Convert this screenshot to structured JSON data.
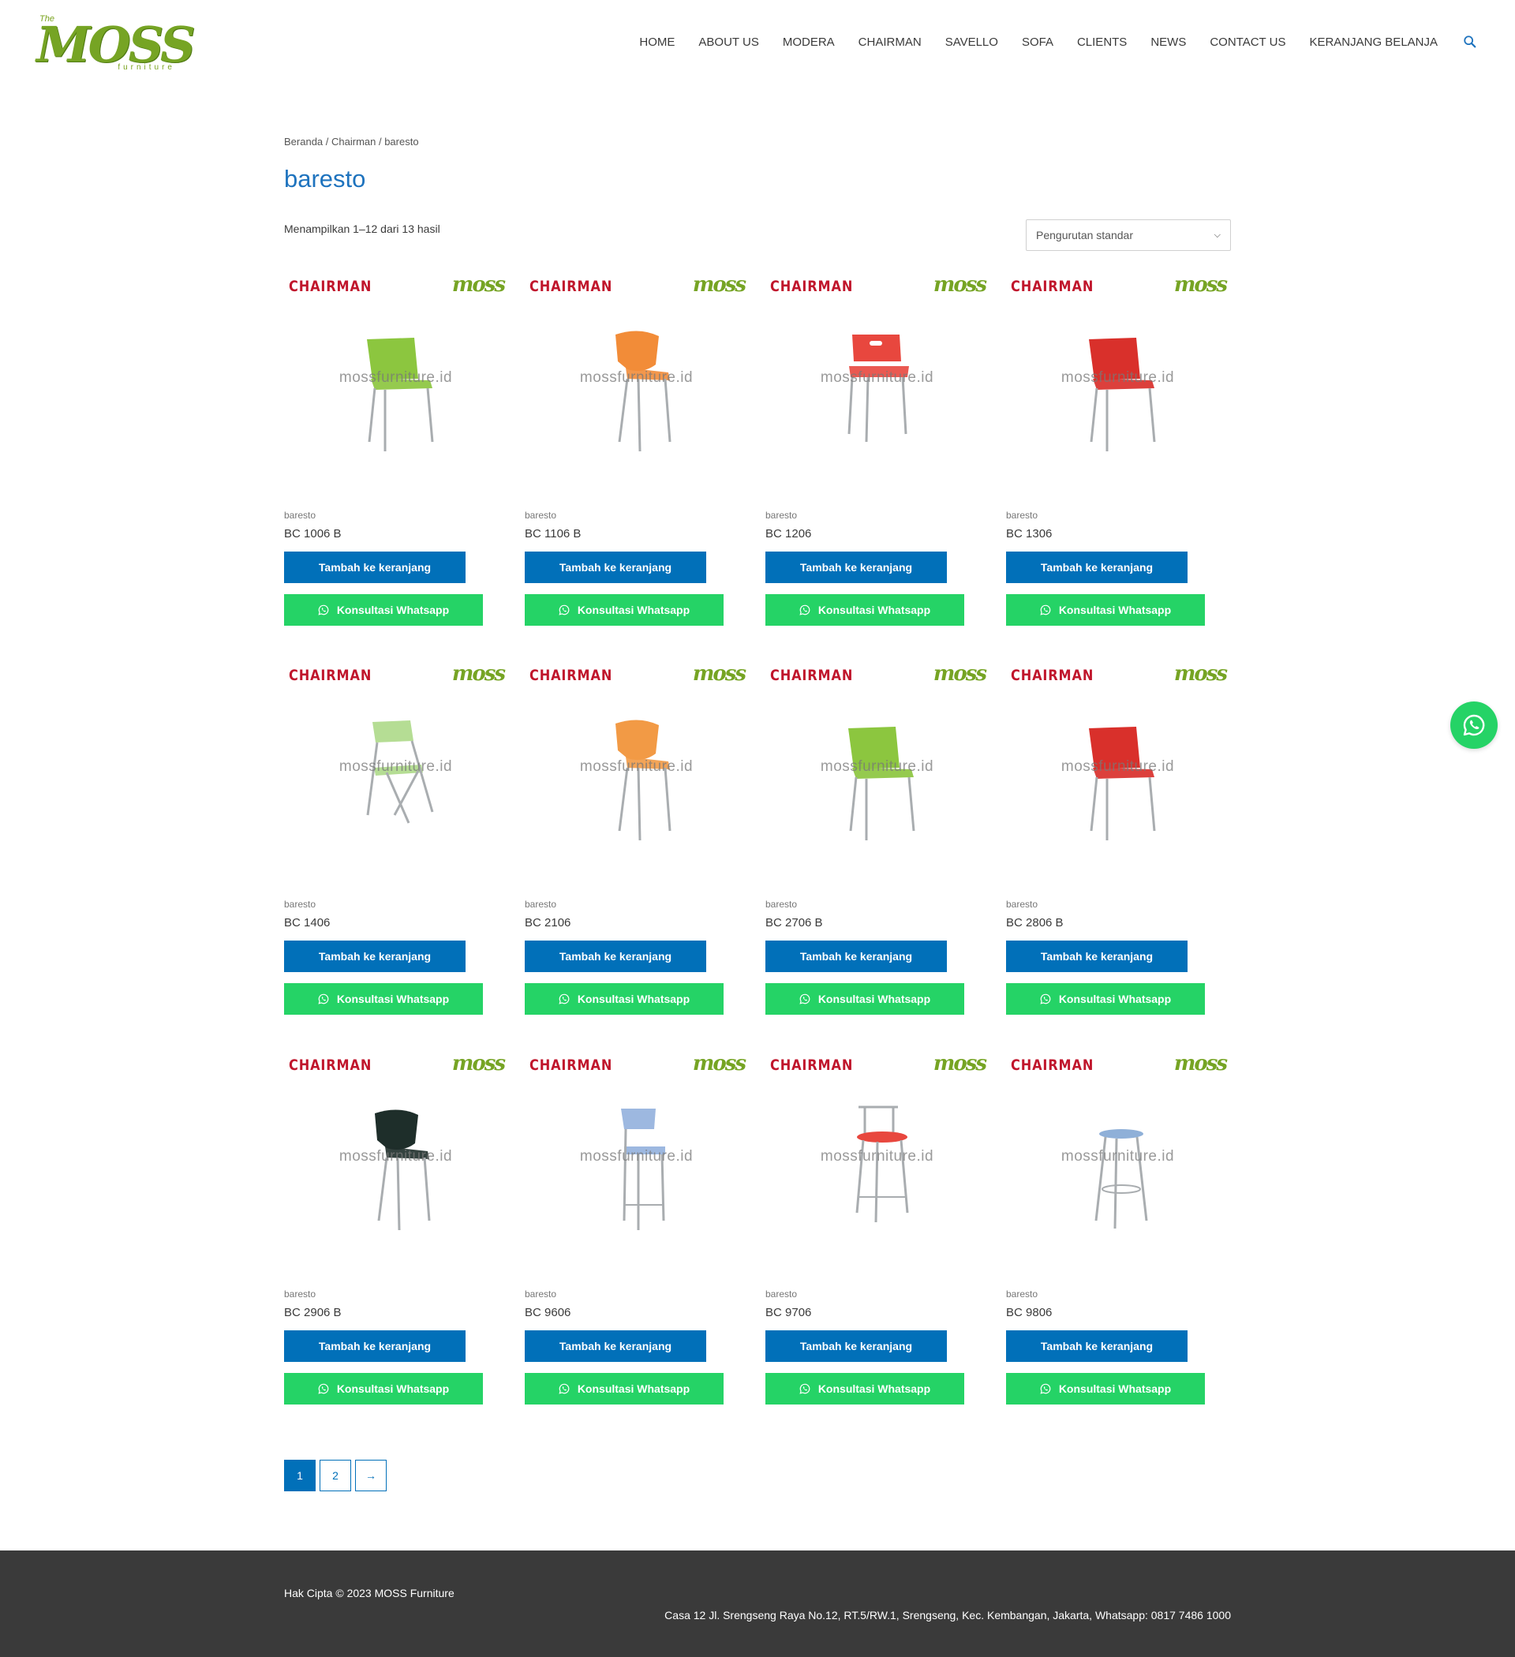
{
  "logo": {
    "the": "The",
    "wordmark": "MOSS",
    "sub": "furniture"
  },
  "nav": {
    "items": [
      "HOME",
      "ABOUT US",
      "MODERA",
      "CHAIRMAN",
      "SAVELLO",
      "SOFA",
      "CLIENTS",
      "NEWS",
      "CONTACT US",
      "KERANJANG BELANJA"
    ],
    "search_icon": "search-icon"
  },
  "breadcrumb": {
    "home": "Beranda",
    "sep": " / ",
    "parent": "Chairman",
    "current": "baresto"
  },
  "page_title": "baresto",
  "result_count": "Menampilkan 1–12 dari 13 hasil",
  "sort": {
    "selected": "Pengurutan standar"
  },
  "product_image": {
    "brand": "CHAIRMAN",
    "mark": "moss",
    "watermark": "mossfurniture.id"
  },
  "buttons": {
    "cart": "Tambah ke keranjang",
    "whatsapp": "Konsultasi Whatsapp"
  },
  "products": [
    {
      "category": "baresto",
      "name": "BC 1006 B",
      "color": "#8cc63f",
      "style": "stack"
    },
    {
      "category": "baresto",
      "name": "BC 1106 B",
      "color": "#f28c38",
      "style": "shell"
    },
    {
      "category": "baresto",
      "name": "BC 1206",
      "color": "#e8473e",
      "style": "handle"
    },
    {
      "category": "baresto",
      "name": "BC 1306",
      "color": "#d9302b",
      "style": "stack"
    },
    {
      "category": "baresto",
      "name": "BC 1406",
      "color": "#b5dd94",
      "style": "folding"
    },
    {
      "category": "baresto",
      "name": "BC 2106",
      "color": "#f29a45",
      "style": "shell"
    },
    {
      "category": "baresto",
      "name": "BC 2706 B",
      "color": "#8cc63f",
      "style": "stack"
    },
    {
      "category": "baresto",
      "name": "BC 2806 B",
      "color": "#d9302b",
      "style": "stack"
    },
    {
      "category": "baresto",
      "name": "BC 2906 B",
      "color": "#1e2e2a",
      "style": "shell"
    },
    {
      "category": "baresto",
      "name": "BC 9606",
      "color": "#9db8e0",
      "style": "barstool"
    },
    {
      "category": "baresto",
      "name": "BC 9706",
      "color": "#e8473e",
      "style": "barback"
    },
    {
      "category": "baresto",
      "name": "BC 9806",
      "color": "#8fb0d8",
      "style": "stool"
    }
  ],
  "pagination": [
    "1",
    "2",
    "→"
  ],
  "footer": {
    "copyright": "Hak Cipta © 2023 MOSS Furniture",
    "address": "Casa 12 Jl. Srengseng Raya No.12, RT.5/RW.1, Srengseng, Kec. Kembangan, Jakarta, Whatsapp: 0817 7486 1000"
  },
  "colors": {
    "primary": "#0170b9",
    "whatsapp": "#25d366",
    "footer": "#3a3a3a",
    "title": "#1e73be"
  }
}
